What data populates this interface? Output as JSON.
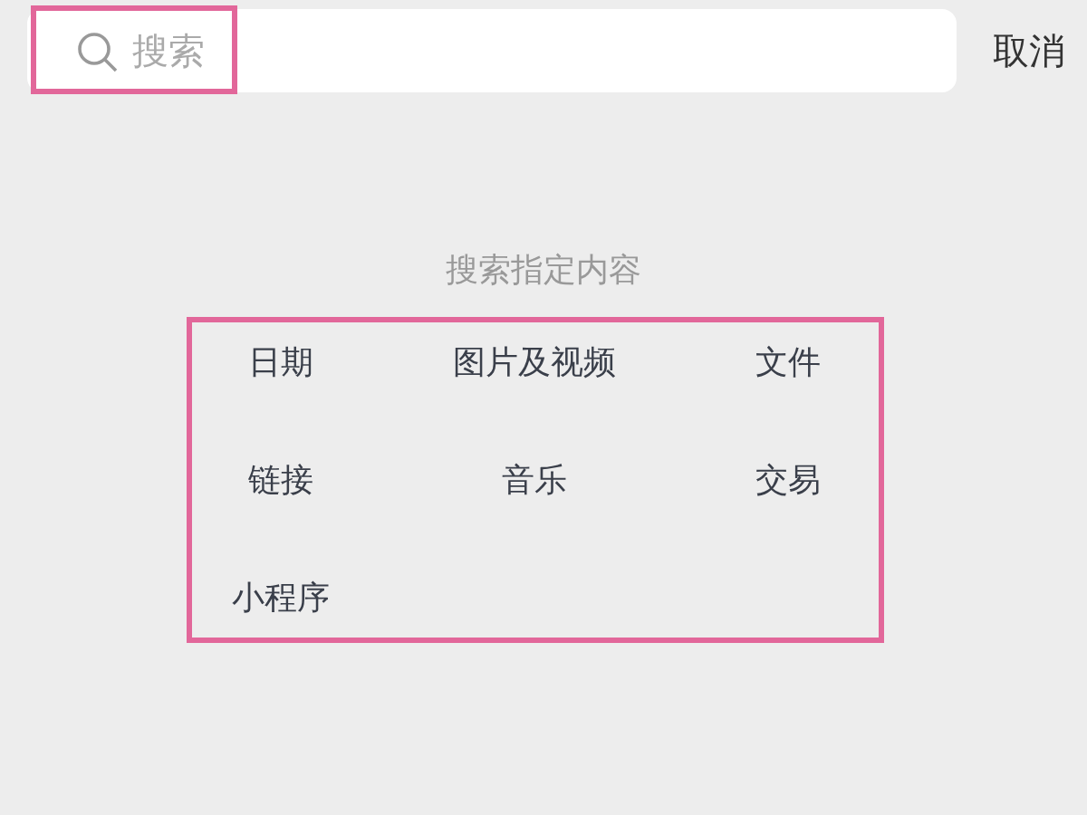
{
  "search": {
    "placeholder": "搜索",
    "highlighted": true
  },
  "cancel_button": "取消",
  "section_title": "搜索指定内容",
  "filters": {
    "highlighted": true,
    "items": [
      {
        "label": "日期"
      },
      {
        "label": "图片及视频"
      },
      {
        "label": "文件"
      },
      {
        "label": "链接"
      },
      {
        "label": "音乐"
      },
      {
        "label": "交易"
      },
      {
        "label": "小程序"
      }
    ]
  }
}
